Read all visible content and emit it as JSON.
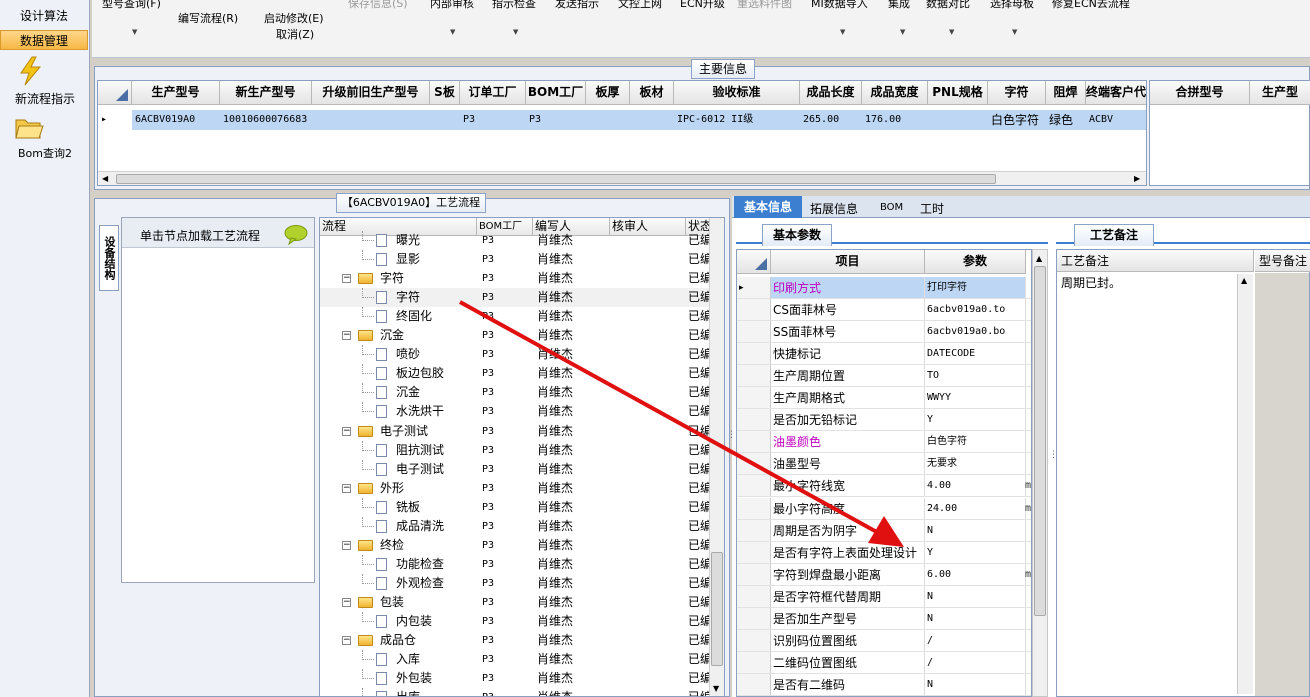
{
  "sidebar": {
    "menu": [
      "设计算法",
      "数据管理"
    ],
    "shortcuts": [
      {
        "label": "新流程指示",
        "icon": "lightning-icon"
      },
      {
        "label": "Bom查询2",
        "icon": "folder-open-icon"
      }
    ]
  },
  "toolbar": {
    "row1": [
      "型号查询(F)",
      "保存信息(S)",
      "内部审核",
      "指示检查",
      "发送指示",
      "文控上网",
      "ECN升级",
      "重选料件图",
      "MI数据导入",
      "集成",
      "数据对比",
      "选择母板",
      "修复ECN去流程"
    ],
    "edit_flow": "编写流程(R)",
    "start_modify": "启动修改(E)",
    "cancel": "取消(Z)"
  },
  "main_info": {
    "caption": "主要信息",
    "columns": [
      "生产型号",
      "新生产型号",
      "升级前旧生产型号",
      "S板",
      "订单工厂",
      "BOM工厂",
      "板厚",
      "板材",
      "验收标准",
      "成品长度",
      "成品宽度",
      "PNL规格",
      "字符",
      "阻焊",
      "终端客户代码"
    ],
    "row": [
      "6ACBV019A0",
      "10010600076683",
      "",
      "",
      "P3",
      "P3",
      "",
      "",
      "IPC-6012 II级",
      "265.00",
      "176.00",
      "",
      "白色字符",
      "绿色",
      "ACBV"
    ],
    "right_columns": [
      "合拼型号",
      "生产型"
    ]
  },
  "process_panel": {
    "caption": "【6ACBV019A0】工艺流程",
    "side_tab": "设备结构",
    "hint": "单击节点加载工艺流程",
    "columns": [
      "流程",
      "BOM工厂",
      "编写人",
      "核审人",
      "状态"
    ],
    "rows": [
      {
        "name": "曝光",
        "level": 2,
        "factory": "P3",
        "author": "肖维杰",
        "reviewer": "",
        "status": "已编"
      },
      {
        "name": "显影",
        "level": 2,
        "factory": "P3",
        "author": "肖维杰",
        "reviewer": "",
        "status": "已编"
      },
      {
        "name": "字符",
        "level": 1,
        "factory": "P3",
        "author": "肖维杰",
        "reviewer": "",
        "status": "已编"
      },
      {
        "name": "字符",
        "level": 2,
        "factory": "P3",
        "author": "肖维杰",
        "reviewer": "",
        "status": "已编"
      },
      {
        "name": "终固化",
        "level": 2,
        "factory": "P3",
        "author": "肖维杰",
        "reviewer": "",
        "status": "已编"
      },
      {
        "name": "沉金",
        "level": 1,
        "factory": "P3",
        "author": "肖维杰",
        "reviewer": "",
        "status": "已编"
      },
      {
        "name": "喷砂",
        "level": 2,
        "factory": "P3",
        "author": "肖维杰",
        "reviewer": "",
        "status": "已编"
      },
      {
        "name": "板边包胶",
        "level": 2,
        "factory": "P3",
        "author": "肖维杰",
        "reviewer": "",
        "status": "已编"
      },
      {
        "name": "沉金",
        "level": 2,
        "factory": "P3",
        "author": "肖维杰",
        "reviewer": "",
        "status": "已编"
      },
      {
        "name": "水洗烘干",
        "level": 2,
        "factory": "P3",
        "author": "肖维杰",
        "reviewer": "",
        "status": "已编"
      },
      {
        "name": "电子测试",
        "level": 1,
        "factory": "P3",
        "author": "肖维杰",
        "reviewer": "",
        "status": "已编"
      },
      {
        "name": "阻抗测试",
        "level": 2,
        "factory": "P3",
        "author": "肖维杰",
        "reviewer": "",
        "status": "已编"
      },
      {
        "name": "电子测试",
        "level": 2,
        "factory": "P3",
        "author": "肖维杰",
        "reviewer": "",
        "status": "已编"
      },
      {
        "name": "外形",
        "level": 1,
        "factory": "P3",
        "author": "肖维杰",
        "reviewer": "",
        "status": "已编"
      },
      {
        "name": "铣板",
        "level": 2,
        "factory": "P3",
        "author": "肖维杰",
        "reviewer": "",
        "status": "已编"
      },
      {
        "name": "成品清洗",
        "level": 2,
        "factory": "P3",
        "author": "肖维杰",
        "reviewer": "",
        "status": "已编"
      },
      {
        "name": "终检",
        "level": 1,
        "factory": "P3",
        "author": "肖维杰",
        "reviewer": "",
        "status": "已编"
      },
      {
        "name": "功能检查",
        "level": 2,
        "factory": "P3",
        "author": "肖维杰",
        "reviewer": "",
        "status": "已编"
      },
      {
        "name": "外观检查",
        "level": 2,
        "factory": "P3",
        "author": "肖维杰",
        "reviewer": "",
        "status": "已编"
      },
      {
        "name": "包装",
        "level": 1,
        "factory": "P3",
        "author": "肖维杰",
        "reviewer": "",
        "status": "已编"
      },
      {
        "name": "内包装",
        "level": 2,
        "factory": "P3",
        "author": "肖维杰",
        "reviewer": "",
        "status": "已编"
      },
      {
        "name": "成品仓",
        "level": 1,
        "factory": "P3",
        "author": "肖维杰",
        "reviewer": "",
        "status": "已编"
      },
      {
        "name": "入库",
        "level": 2,
        "factory": "P3",
        "author": "肖维杰",
        "reviewer": "",
        "status": "已编"
      },
      {
        "name": "外包装",
        "level": 2,
        "factory": "P3",
        "author": "肖维杰",
        "reviewer": "",
        "status": "已编"
      },
      {
        "name": "出库",
        "level": 2,
        "factory": "P3",
        "author": "肖维杰",
        "reviewer": "",
        "status": "已编"
      }
    ]
  },
  "right_tabs": [
    "基本信息",
    "拓展信息",
    "BOM",
    "工时"
  ],
  "basic_params": {
    "caption": "基本参数",
    "columns": [
      "项目",
      "参数"
    ],
    "rows": [
      {
        "item": "印刷方式",
        "value": "打印字符",
        "unit": "",
        "highlight": true
      },
      {
        "item": "CS面菲林号",
        "value": "6acbv019a0.to",
        "unit": ""
      },
      {
        "item": "SS面菲林号",
        "value": "6acbv019a0.bo",
        "unit": ""
      },
      {
        "item": "快捷标记",
        "value": "DATECODE",
        "unit": ""
      },
      {
        "item": "生产周期位置",
        "value": "TO",
        "unit": ""
      },
      {
        "item": "生产周期格式",
        "value": "WWYY",
        "unit": ""
      },
      {
        "item": "是否加无铅标记",
        "value": "Y",
        "unit": ""
      },
      {
        "item": "油墨颜色",
        "value": "白色字符",
        "unit": "",
        "highlight": true
      },
      {
        "item": "油墨型号",
        "value": "无要求",
        "unit": ""
      },
      {
        "item": "最小字符线宽",
        "value": "4.00",
        "unit": "m"
      },
      {
        "item": "最小字符高度",
        "value": "24.00",
        "unit": "m"
      },
      {
        "item": "周期是否为阴字",
        "value": "N",
        "unit": ""
      },
      {
        "item": "是否有字符上表面处理设计",
        "value": "Y",
        "unit": ""
      },
      {
        "item": "字符到焊盘最小距离",
        "value": "6.00",
        "unit": "m"
      },
      {
        "item": "是否字符框代替周期",
        "value": "N",
        "unit": ""
      },
      {
        "item": "是否加生产型号",
        "value": "N",
        "unit": ""
      },
      {
        "item": "识别码位置图纸",
        "value": "/",
        "unit": ""
      },
      {
        "item": "二维码位置图纸",
        "value": "/",
        "unit": ""
      },
      {
        "item": "是否有二维码",
        "value": "N",
        "unit": ""
      }
    ]
  },
  "remark": {
    "caption": "工艺备注",
    "col1": "工艺备注",
    "col2": "型号备注",
    "text": "周期已封。"
  },
  "colors": {
    "accent": "#3c7fd0",
    "selected_row": "#bcd6f4",
    "highlight_text": "#c000c0",
    "arrow": "#e01010"
  }
}
